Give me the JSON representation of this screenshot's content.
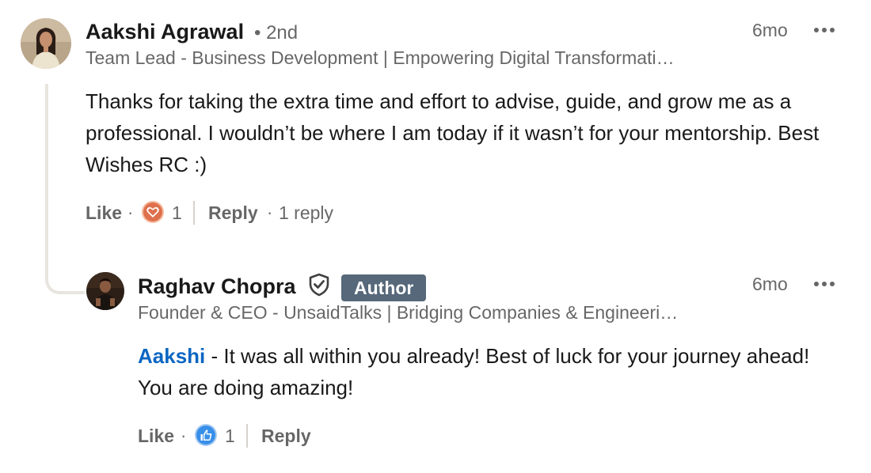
{
  "comment": {
    "author_name": "Aakshi Agrawal",
    "degree": "• 2nd",
    "headline": "Team Lead - Business Development | Empowering Digital Transformati…",
    "time": "6mo",
    "more_icon": "more-horizontal-icon",
    "text": "Thanks for taking the extra time and effort to advise, guide, and grow me as a professional. I wouldn’t be where I am today if it wasn’t for your mentorship. Best Wishes RC :)",
    "like_label": "Like",
    "dot": "·",
    "reaction_icon": "love-reaction-icon",
    "reaction_count": "1",
    "reply_label": "Reply",
    "reply_count": "1 reply"
  },
  "reply": {
    "author_name": "Raghav Chopra",
    "verified_icon": "verified-shield-icon",
    "badge": "Author",
    "headline": "Founder & CEO - UnsaidTalks | Bridging Companies & Engineeri…",
    "time": "6mo",
    "more_icon": "more-horizontal-icon",
    "mention": "Aakshi",
    "text": " - It was all within you already! Best of luck for your journey ahead! You are doing amazing!",
    "like_label": "Like",
    "dot": "·",
    "reaction_icon": "like-reaction-icon",
    "reaction_count": "1",
    "reply_label": "Reply"
  },
  "colors": {
    "mention": "#0a66c2",
    "author_badge_bg": "#56687a",
    "love_reaction": "#df704d",
    "like_reaction": "#378fe9",
    "thread_line": "#e8e5df"
  }
}
